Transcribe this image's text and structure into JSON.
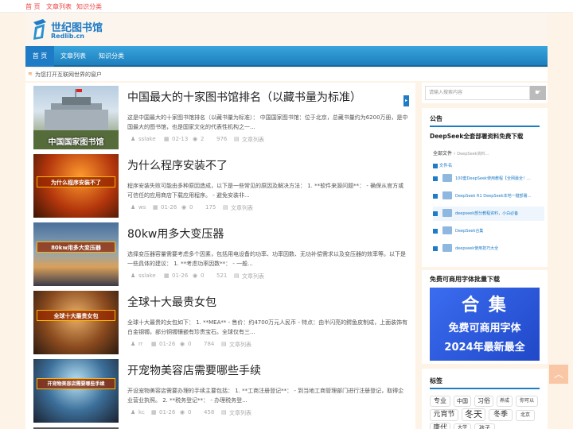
{
  "topbar": {
    "items": [
      "首 页",
      "文章列表",
      "知识分类"
    ]
  },
  "logo": {
    "title": "世纪图书馆",
    "subtitle": "Redlib.cn"
  },
  "nav": {
    "items": [
      "首 页",
      "文章列表",
      "知识分类"
    ]
  },
  "notice": {
    "text": "为您打开互联网世界的窗户"
  },
  "posts": [
    {
      "title": "中国最大的十家图书馆排名（以藏书量为标准）",
      "excerpt": "这是中国最大的十家图书馆排名（以藏书量为标准）： 中国国家图书馆：位于北京，总藏书量约为6200万册，是中国最大的图书馆，也是国家文化的代表性机构之一...",
      "author": "sslake",
      "date": "02-13",
      "comments": "2",
      "views": "976",
      "category": "文章列表",
      "thumb_caption": "中国国家图书馆"
    },
    {
      "title": "为什么程序安装不了",
      "excerpt": "程序安装失败可能由多种原因造成，以下是一些常见的原因及解决方法： 1. **软件来源问题**： - 确保从官方或可信任的应用商店下载应用程序。 - 避免安装非...",
      "author": "ws",
      "date": "01-26",
      "comments": "0",
      "views": "175",
      "category": "文章列表",
      "thumb_caption": "为什么程序安装不了"
    },
    {
      "title": "80kw用多大变压器",
      "excerpt": "选择变压器容量需要考虑多个因素，包括用电设备的功率、功率因数、无功补偿需求以及变压器的效率等。以下是一些具体的建议： 1. **考虑功率因数**： - 一般...",
      "author": "sslake",
      "date": "01-26",
      "comments": "0",
      "views": "521",
      "category": "文章列表",
      "thumb_caption": "80kw用多大变压器"
    },
    {
      "title": "全球十大最贵女包",
      "excerpt": "全球十大最贵的女包如下： 1. **MEA** - 售价：约4700万元人民币 - 特点：由半闪亮的鳄鱼皮制成，上面装饰有白金钢镯，部分铜镯镶嵌有珍贵宝石。全球仅有三...",
      "author": "rr",
      "date": "01-26",
      "comments": "0",
      "views": "784",
      "category": "文章列表",
      "thumb_caption": "全球十大最贵女包"
    },
    {
      "title": "开宠物美容店需要哪些手续",
      "excerpt": "开设宠物美容店需要办理的手续主要包括： 1. **工商注册登记**： - 到当地工商管理部门进行注册登记，取得企业营业执照。 2. **税务登记**： - 办理税务登...",
      "author": "kc",
      "date": "01-26",
      "comments": "0",
      "views": "458",
      "category": "文章列表",
      "thumb_caption": "开宠物美容店需要哪些手续"
    }
  ],
  "sidebar": {
    "search_placeholder": "请输入搜索内容",
    "announce_title": "公告",
    "announce_headline": "DeepSeek全套部署资料免费下载",
    "file_root": "全部文件",
    "file_path": "DeepSeek资料...",
    "file_header": "文件名",
    "files": [
      "100套DeepSeek使用教程【全网最全！...",
      "DeepSeek R1 DeepSeek本地一键部署...",
      "deepseek部分教程资料，小白必备",
      "DeepSeek合集",
      "deepseek使用技巧大全"
    ],
    "font_title": "免费可商用字体批量下载",
    "font_banner": [
      "合 集",
      "免费可商用字体",
      "2024年最新最全"
    ],
    "tags_title": "标签",
    "tags": [
      "专业",
      "中国",
      "习俗",
      "养成",
      "你可以",
      "元宵节",
      "冬天",
      "冬季",
      "北京",
      "唐代",
      "大学",
      "孩子"
    ]
  },
  "colors": {
    "accent": "#1e7bc6",
    "nav": "#2a90d0",
    "background": "#fdf3e6"
  }
}
